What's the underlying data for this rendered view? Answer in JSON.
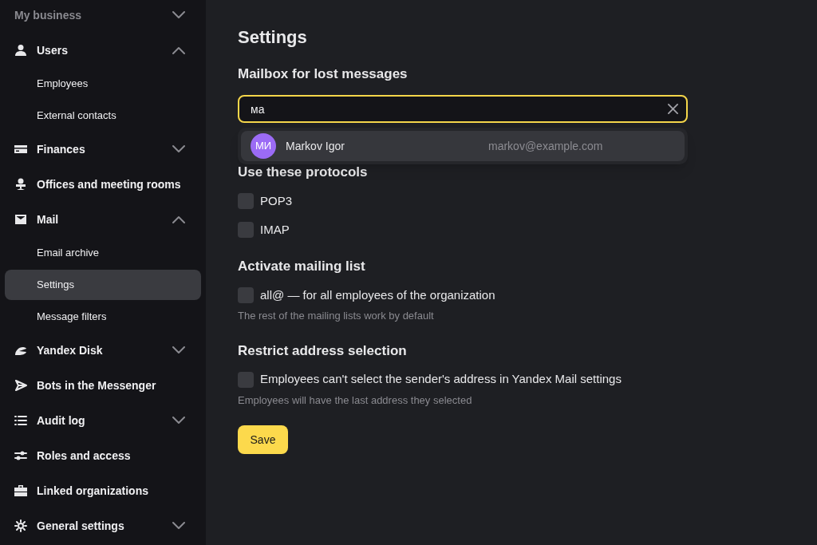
{
  "sidebar": {
    "items": [
      {
        "label": "My business",
        "kind": "none",
        "muted": true,
        "expanded": false
      },
      {
        "label": "Users",
        "kind": "user",
        "expanded": true,
        "children": [
          {
            "label": "Employees",
            "selected": false
          },
          {
            "label": "External contacts",
            "selected": false
          }
        ]
      },
      {
        "label": "Finances",
        "kind": "card",
        "expanded": false
      },
      {
        "label": "Offices and meeting rooms",
        "kind": "chair"
      },
      {
        "label": "Mail",
        "kind": "mail",
        "expanded": true,
        "children": [
          {
            "label": "Email archive",
            "selected": false
          },
          {
            "label": "Settings",
            "selected": true
          },
          {
            "label": "Message filters",
            "selected": false
          }
        ]
      },
      {
        "label": "Yandex Disk",
        "kind": "disk",
        "expanded": false
      },
      {
        "label": "Bots in the Messenger",
        "kind": "send"
      },
      {
        "label": "Audit log",
        "kind": "list",
        "expanded": false
      },
      {
        "label": "Roles and access",
        "kind": "sliders"
      },
      {
        "label": "Linked organizations",
        "kind": "briefcase"
      },
      {
        "label": "General settings",
        "kind": "gear",
        "expanded": false
      }
    ]
  },
  "main": {
    "title": "Settings",
    "lost_mailbox": {
      "heading": "Mailbox for lost messages",
      "value": "ма",
      "suggestions": [
        {
          "initials": "МИ",
          "name": "Markov Igor",
          "email": "markov@example.com"
        }
      ]
    },
    "sections": [
      {
        "heading": "Use these protocols",
        "options": [
          {
            "label": "POP3",
            "checked": false
          },
          {
            "label": "IMAP",
            "checked": false
          }
        ]
      },
      {
        "heading": "Activate mailing list",
        "options": [
          {
            "label": "all@ — for all employees of the organization",
            "checked": false
          }
        ],
        "hint": "The rest of the mailing lists work by default"
      },
      {
        "heading": "Restrict address selection",
        "options": [
          {
            "label": "Employees can't select the sender's address in Yandex Mail settings",
            "checked": false
          }
        ],
        "hint": "Employees will have the last address they selected"
      }
    ],
    "save_button": "Save"
  }
}
